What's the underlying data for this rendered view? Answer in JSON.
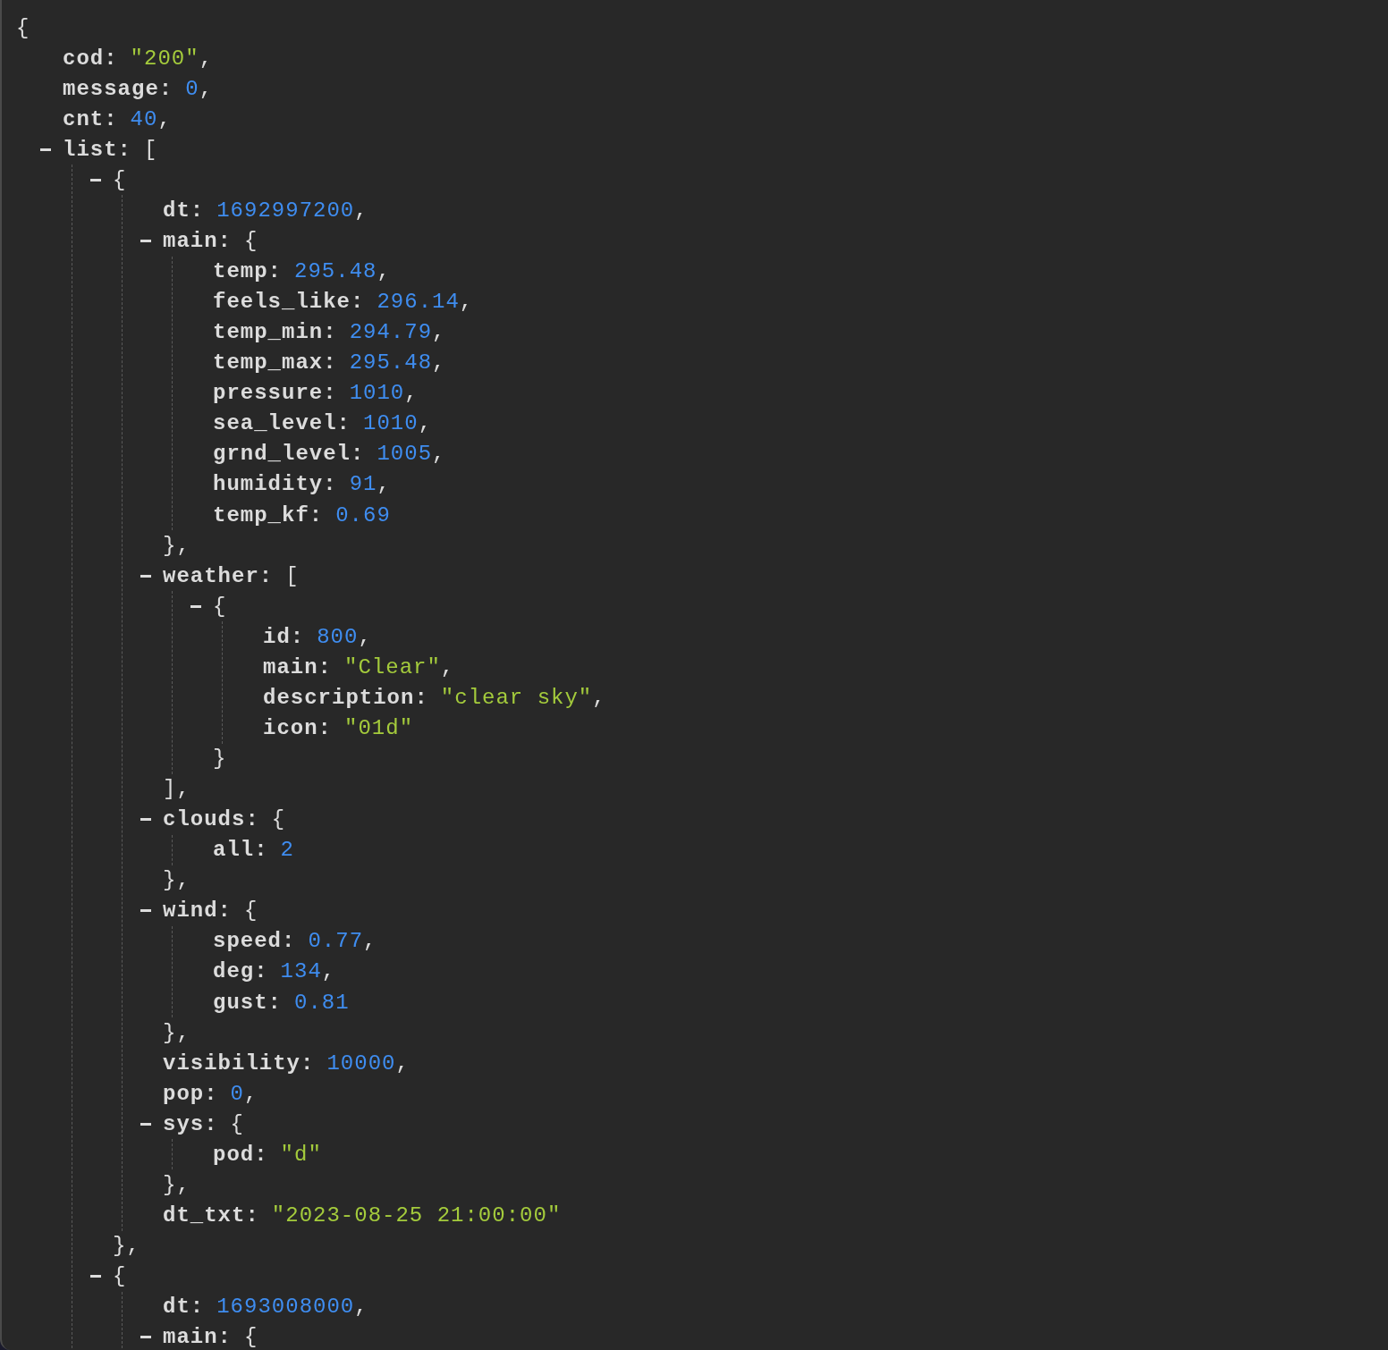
{
  "viewer": {
    "root": {
      "kind": "object",
      "open": "{",
      "children": [
        {
          "kind": "string",
          "key": "cod:",
          "value": "\"200\"",
          "punct": ","
        },
        {
          "kind": "number",
          "key": "message:",
          "value": "0",
          "punct": ","
        },
        {
          "kind": "number",
          "key": "cnt:",
          "value": "40",
          "punct": ","
        },
        {
          "kind": "array",
          "key": "list:",
          "open": "[",
          "expanded": true,
          "children": [
            {
              "kind": "object",
              "open": "{",
              "expanded": true,
              "close": "},",
              "children": [
                {
                  "kind": "number",
                  "key": "dt:",
                  "value": "1692997200",
                  "punct": ","
                },
                {
                  "kind": "object",
                  "key": "main:",
                  "open": "{",
                  "expanded": true,
                  "close": "},",
                  "children": [
                    {
                      "kind": "number",
                      "key": "temp:",
                      "value": "295.48",
                      "punct": ","
                    },
                    {
                      "kind": "number",
                      "key": "feels_like:",
                      "value": "296.14",
                      "punct": ","
                    },
                    {
                      "kind": "number",
                      "key": "temp_min:",
                      "value": "294.79",
                      "punct": ","
                    },
                    {
                      "kind": "number",
                      "key": "temp_max:",
                      "value": "295.48",
                      "punct": ","
                    },
                    {
                      "kind": "number",
                      "key": "pressure:",
                      "value": "1010",
                      "punct": ","
                    },
                    {
                      "kind": "number",
                      "key": "sea_level:",
                      "value": "1010",
                      "punct": ","
                    },
                    {
                      "kind": "number",
                      "key": "grnd_level:",
                      "value": "1005",
                      "punct": ","
                    },
                    {
                      "kind": "number",
                      "key": "humidity:",
                      "value": "91",
                      "punct": ","
                    },
                    {
                      "kind": "number",
                      "key": "temp_kf:",
                      "value": "0.69"
                    }
                  ]
                },
                {
                  "kind": "array",
                  "key": "weather:",
                  "open": "[",
                  "expanded": true,
                  "close": "],",
                  "children": [
                    {
                      "kind": "object",
                      "open": "{",
                      "expanded": true,
                      "close": "}",
                      "children": [
                        {
                          "kind": "number",
                          "key": "id:",
                          "value": "800",
                          "punct": ","
                        },
                        {
                          "kind": "string",
                          "key": "main:",
                          "value": "\"Clear\"",
                          "punct": ","
                        },
                        {
                          "kind": "string",
                          "key": "description:",
                          "value": "\"clear sky\"",
                          "punct": ","
                        },
                        {
                          "kind": "string",
                          "key": "icon:",
                          "value": "\"01d\""
                        }
                      ]
                    }
                  ]
                },
                {
                  "kind": "object",
                  "key": "clouds:",
                  "open": "{",
                  "expanded": true,
                  "close": "},",
                  "children": [
                    {
                      "kind": "number",
                      "key": "all:",
                      "value": "2"
                    }
                  ]
                },
                {
                  "kind": "object",
                  "key": "wind:",
                  "open": "{",
                  "expanded": true,
                  "close": "},",
                  "children": [
                    {
                      "kind": "number",
                      "key": "speed:",
                      "value": "0.77",
                      "punct": ","
                    },
                    {
                      "kind": "number",
                      "key": "deg:",
                      "value": "134",
                      "punct": ","
                    },
                    {
                      "kind": "number",
                      "key": "gust:",
                      "value": "0.81"
                    }
                  ]
                },
                {
                  "kind": "number",
                  "key": "visibility:",
                  "value": "10000",
                  "punct": ","
                },
                {
                  "kind": "number",
                  "key": "pop:",
                  "value": "0",
                  "punct": ","
                },
                {
                  "kind": "object",
                  "key": "sys:",
                  "open": "{",
                  "expanded": true,
                  "close": "},",
                  "children": [
                    {
                      "kind": "string",
                      "key": "pod:",
                      "value": "\"d\""
                    }
                  ]
                },
                {
                  "kind": "string",
                  "key": "dt_txt:",
                  "value": "\"2023-08-25 21:00:00\""
                }
              ]
            },
            {
              "kind": "object",
              "open": "{",
              "expanded": true,
              "children": [
                {
                  "kind": "number",
                  "key": "dt:",
                  "value": "1693008000",
                  "punct": ","
                },
                {
                  "kind": "object",
                  "key": "main:",
                  "open": "{",
                  "expanded": true
                }
              ]
            }
          ]
        }
      ]
    }
  }
}
